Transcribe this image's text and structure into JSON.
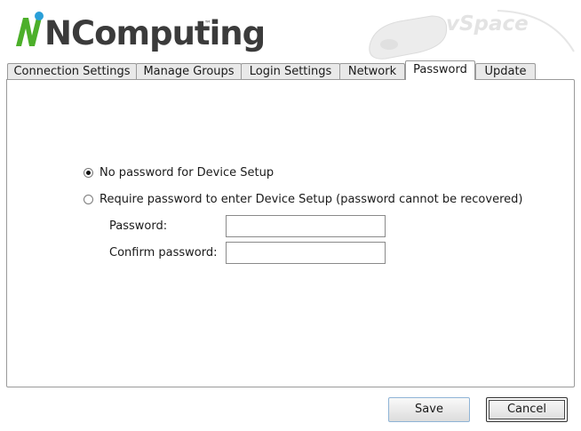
{
  "header": {
    "logo_text": "NComputing",
    "logo_tm": "™",
    "product_text": "vSpace",
    "colors": {
      "logo_green": "#4caf2a",
      "logo_dot": "#2a9fd8",
      "logo_gray": "#3b3b3b"
    }
  },
  "tabs": [
    {
      "label": "Connection Settings",
      "active": false
    },
    {
      "label": "Manage Groups",
      "active": false
    },
    {
      "label": "Login Settings",
      "active": false
    },
    {
      "label": "Network",
      "active": false
    },
    {
      "label": "Password",
      "active": true
    },
    {
      "label": "Update",
      "active": false
    }
  ],
  "password_panel": {
    "option_no_password": {
      "label": "No password for Device Setup",
      "selected": true
    },
    "option_require_password": {
      "label": "Require password to enter Device Setup (password cannot be recovered)",
      "selected": false
    },
    "password_label": "Password:",
    "password_value": "",
    "confirm_label": "Confirm password:",
    "confirm_value": ""
  },
  "buttons": {
    "save_label": "Save",
    "cancel_label": "Cancel"
  }
}
